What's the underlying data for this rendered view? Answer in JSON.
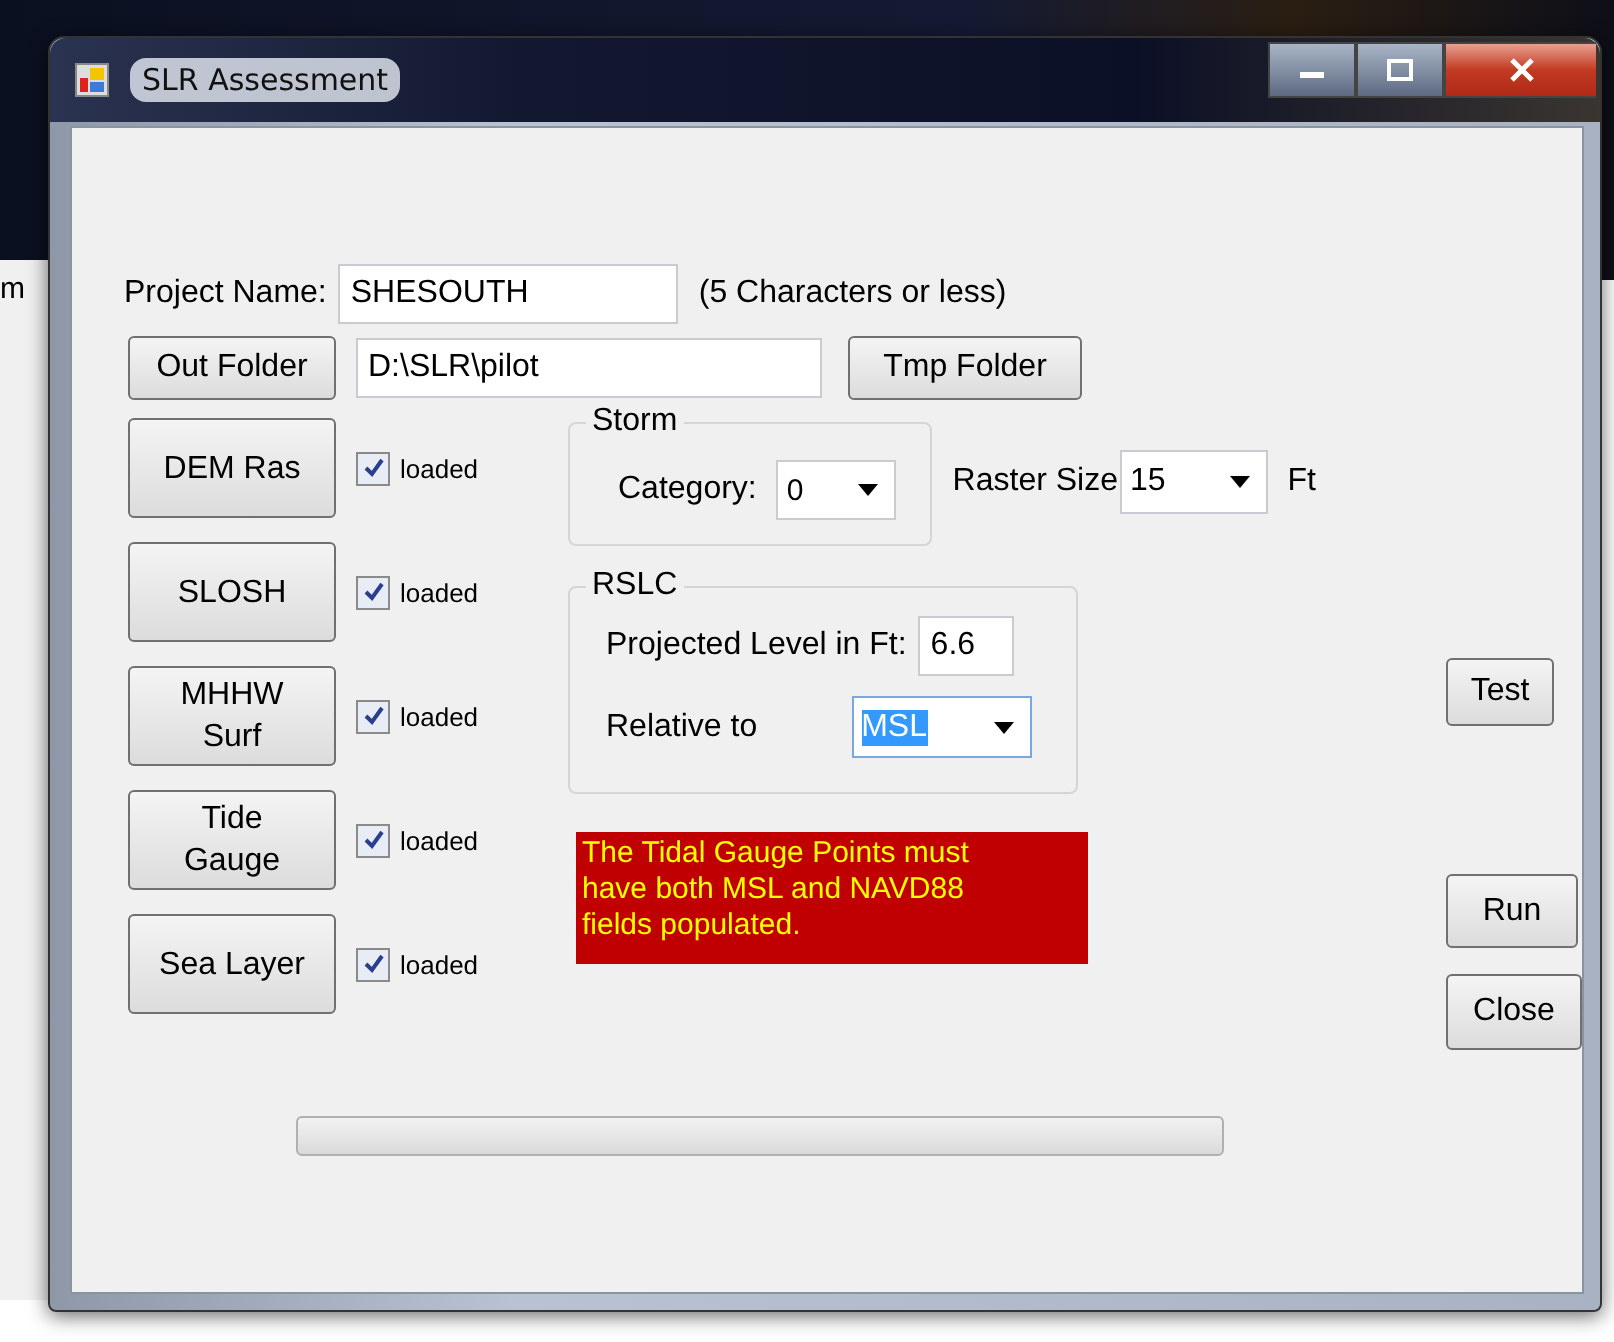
{
  "background_window": {
    "text": "m"
  },
  "window": {
    "title": "SLR Assessment"
  },
  "project_name": {
    "label": "Project Name:",
    "value": "SHESOUTH",
    "note": "(5 Characters or less)"
  },
  "out_folder": {
    "button": "Out Folder",
    "value": "D:\\SLR\\pilot",
    "tmp_button": "Tmp Folder"
  },
  "layers": [
    {
      "button": "DEM Ras",
      "checked": true,
      "label": "loaded"
    },
    {
      "button": "SLOSH",
      "checked": true,
      "label": "loaded"
    },
    {
      "button": "MHHW Surf",
      "checked": true,
      "label": "loaded"
    },
    {
      "button": "Tide Gauge",
      "checked": true,
      "label": "loaded"
    },
    {
      "button": "Sea Layer",
      "checked": true,
      "label": "loaded"
    }
  ],
  "storm": {
    "title": "Storm",
    "label": "Category:",
    "value": "0"
  },
  "raster": {
    "label": "Raster Size",
    "value": "15",
    "unit": "Ft"
  },
  "rslc": {
    "title": "RSLC",
    "level_label": "Projected Level in Ft:",
    "level_value": "6.6",
    "relative_label": "Relative to",
    "relative_value": "MSL"
  },
  "message": "The Tidal Gauge Points must have both MSL and NAVD88 fields populated.",
  "buttons": {
    "test": "Test",
    "run": "Run",
    "close": "Close"
  },
  "progress": {
    "level": 0
  }
}
